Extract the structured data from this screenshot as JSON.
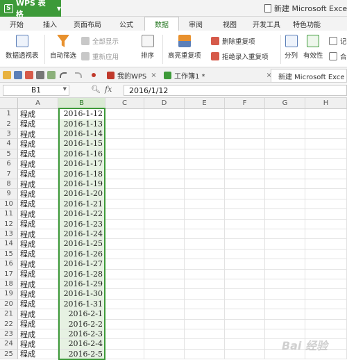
{
  "app": {
    "name": "WPS 表格",
    "window_title": "新建 Microsoft Exce"
  },
  "tabs": [
    "开始",
    "插入",
    "页面布局",
    "公式",
    "数据",
    "审阅",
    "视图",
    "开发工具",
    "特色功能"
  ],
  "active_tab": "数据",
  "ribbon": {
    "pivot": "数据透视表",
    "autofilter": "自动筛选",
    "show_all": "全部显示",
    "reapply": "重新应用",
    "sort": "排序",
    "highlight_dup": "高亮重复项",
    "remove_dup": "删除重复项",
    "reject_dup": "拒绝录入重复项",
    "split": "分列",
    "validity": "有效性",
    "record": "记",
    "merge": "合"
  },
  "doc_tabs": {
    "mywps": "我的WPS",
    "book1": "工作簿1 *",
    "active": "新建 Microsoft Exce"
  },
  "formula_bar": {
    "name_box": "B1",
    "fx": "fx",
    "value": "2016/1/12"
  },
  "columns": [
    "A",
    "B",
    "C",
    "D",
    "E",
    "F",
    "G",
    "H"
  ],
  "rows": [
    {
      "n": "1",
      "a": "程成",
      "b": "2016-1-12"
    },
    {
      "n": "2",
      "a": "程成",
      "b": "2016-1-13"
    },
    {
      "n": "3",
      "a": "程成",
      "b": "2016-1-14"
    },
    {
      "n": "4",
      "a": "程成",
      "b": "2016-1-15"
    },
    {
      "n": "5",
      "a": "程成",
      "b": "2016-1-16"
    },
    {
      "n": "6",
      "a": "程成",
      "b": "2016-1-17"
    },
    {
      "n": "7",
      "a": "程成",
      "b": "2016-1-18"
    },
    {
      "n": "8",
      "a": "程成",
      "b": "2016-1-19"
    },
    {
      "n": "9",
      "a": "程成",
      "b": "2016-1-20"
    },
    {
      "n": "10",
      "a": "程成",
      "b": "2016-1-21"
    },
    {
      "n": "11",
      "a": "程成",
      "b": "2016-1-22"
    },
    {
      "n": "12",
      "a": "程成",
      "b": "2016-1-23"
    },
    {
      "n": "13",
      "a": "程成",
      "b": "2016-1-24"
    },
    {
      "n": "14",
      "a": "程成",
      "b": "2016-1-25"
    },
    {
      "n": "15",
      "a": "程成",
      "b": "2016-1-26"
    },
    {
      "n": "16",
      "a": "程成",
      "b": "2016-1-27"
    },
    {
      "n": "17",
      "a": "程成",
      "b": "2016-1-28"
    },
    {
      "n": "18",
      "a": "程成",
      "b": "2016-1-29"
    },
    {
      "n": "19",
      "a": "程成",
      "b": "2016-1-30"
    },
    {
      "n": "20",
      "a": "程成",
      "b": "2016-1-31"
    },
    {
      "n": "21",
      "a": "程成",
      "b": "2016-2-1"
    },
    {
      "n": "22",
      "a": "程成",
      "b": "2016-2-2"
    },
    {
      "n": "23",
      "a": "程成",
      "b": "2016-2-3"
    },
    {
      "n": "24",
      "a": "程成",
      "b": "2016-2-4"
    },
    {
      "n": "25",
      "a": "程成",
      "b": "2016-2-5"
    }
  ],
  "colors": {
    "accent": "#3d9a39",
    "selection_fill": "#e6f1e2"
  }
}
